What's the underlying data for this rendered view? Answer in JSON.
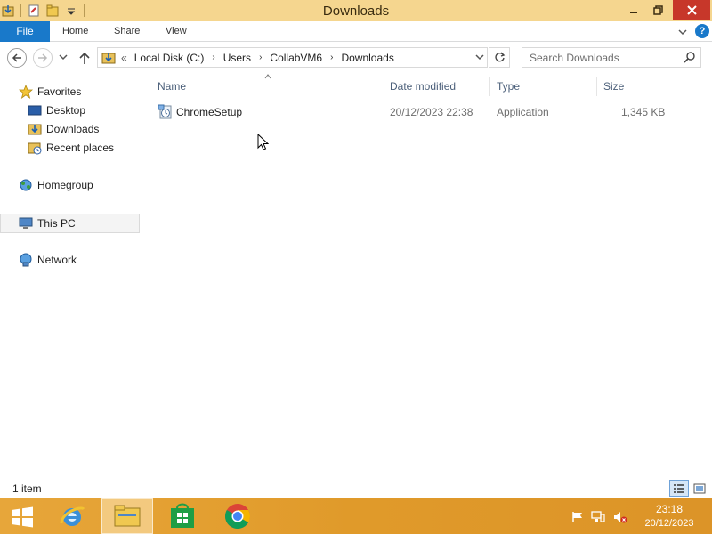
{
  "window": {
    "title": "Downloads"
  },
  "ribbon": {
    "tabs": {
      "file": "File",
      "home": "Home",
      "share": "Share",
      "view": "View"
    },
    "help": "?"
  },
  "address": {
    "overflow": "«",
    "crumbs": [
      "Local Disk (C:)",
      "Users",
      "CollabVM6",
      "Downloads"
    ],
    "separator": "›"
  },
  "search": {
    "placeholder": "Search Downloads"
  },
  "nav": {
    "favorites": "Favorites",
    "desktop": "Desktop",
    "downloads": "Downloads",
    "recent_places": "Recent places",
    "homegroup": "Homegroup",
    "this_pc": "This PC",
    "network": "Network"
  },
  "columns": {
    "name": "Name",
    "date_modified": "Date modified",
    "type": "Type",
    "size": "Size"
  },
  "files": [
    {
      "name": "ChromeSetup",
      "date_modified": "20/12/2023 22:38",
      "type": "Application",
      "size": "1,345 KB",
      "icon": "installer-icon"
    }
  ],
  "status": {
    "item_count": "1 item"
  },
  "taskbar": {
    "apps": [
      "internet-explorer",
      "file-explorer",
      "store",
      "chrome"
    ],
    "clock": {
      "time": "23:18",
      "date": "20/12/2023"
    }
  },
  "colors": {
    "title_bar": "#f5d68f",
    "file_tab": "#1979ca",
    "taskbar": "#e09a2a",
    "close_button": "#c7372a"
  }
}
